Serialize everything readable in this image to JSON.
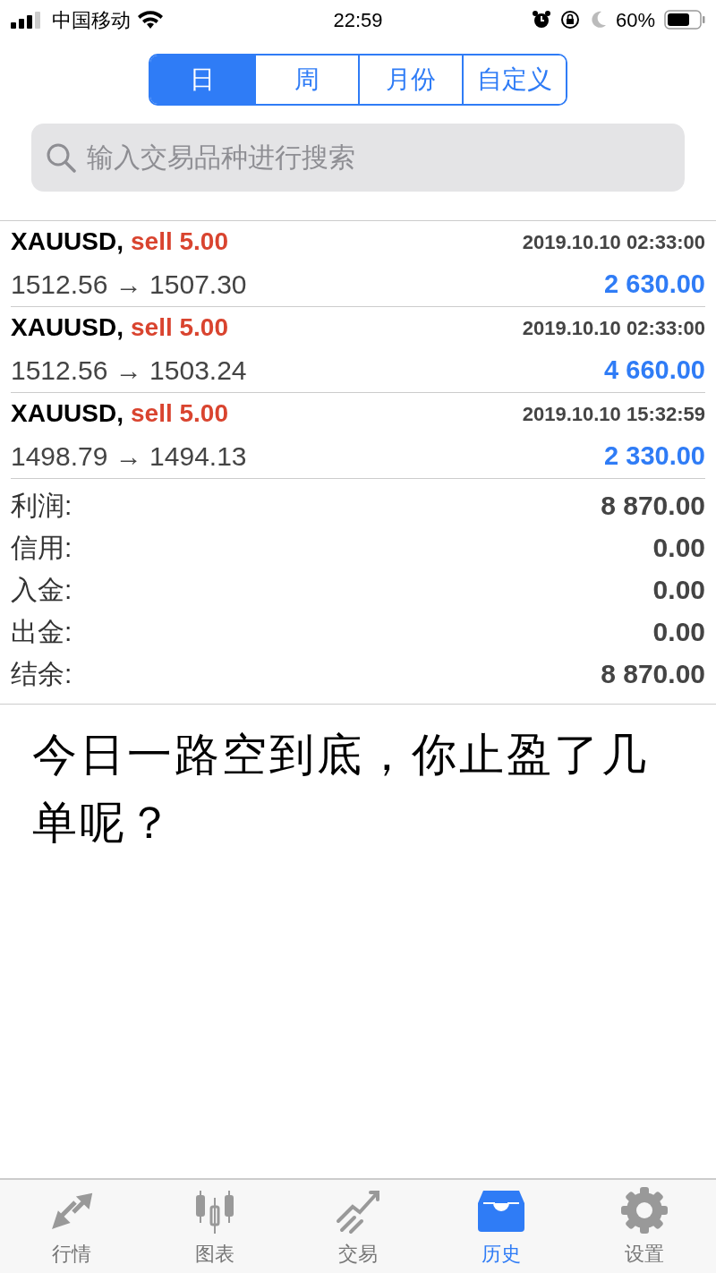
{
  "status_bar": {
    "carrier": "中国移动",
    "time": "22:59",
    "battery": "60%"
  },
  "period_tabs": [
    {
      "label": "日",
      "selected": true
    },
    {
      "label": "周",
      "selected": false
    },
    {
      "label": "月份",
      "selected": false
    },
    {
      "label": "自定义",
      "selected": false
    }
  ],
  "search": {
    "placeholder": "输入交易品种进行搜索"
  },
  "deals": [
    {
      "symbol": "XAUUSD,",
      "action": "sell 5.00",
      "time": "2019.10.10 02:33:00",
      "prices": "1512.56 → 1507.30",
      "profit": "2 630.00"
    },
    {
      "symbol": "XAUUSD,",
      "action": "sell 5.00",
      "time": "2019.10.10 02:33:00",
      "prices": "1512.56 → 1503.24",
      "profit": "4 660.00"
    },
    {
      "symbol": "XAUUSD,",
      "action": "sell 5.00",
      "time": "2019.10.10 15:32:59",
      "prices": "1498.79 → 1494.13",
      "profit": "2 330.00"
    }
  ],
  "summary": [
    {
      "label": "利润:",
      "value": "8 870.00"
    },
    {
      "label": "信用:",
      "value": "0.00"
    },
    {
      "label": "入金:",
      "value": "0.00"
    },
    {
      "label": "出金:",
      "value": "0.00"
    },
    {
      "label": "结余:",
      "value": "8 870.00"
    }
  ],
  "caption": "今日一路空到底，你止盈了几单呢？",
  "tab_bar": [
    {
      "label": "行情",
      "kind": "quotes",
      "selected": false
    },
    {
      "label": "图表",
      "kind": "chart",
      "selected": false
    },
    {
      "label": "交易",
      "kind": "trade",
      "selected": false
    },
    {
      "label": "历史",
      "kind": "history",
      "selected": true
    },
    {
      "label": "设置",
      "kind": "settings",
      "selected": false
    }
  ]
}
